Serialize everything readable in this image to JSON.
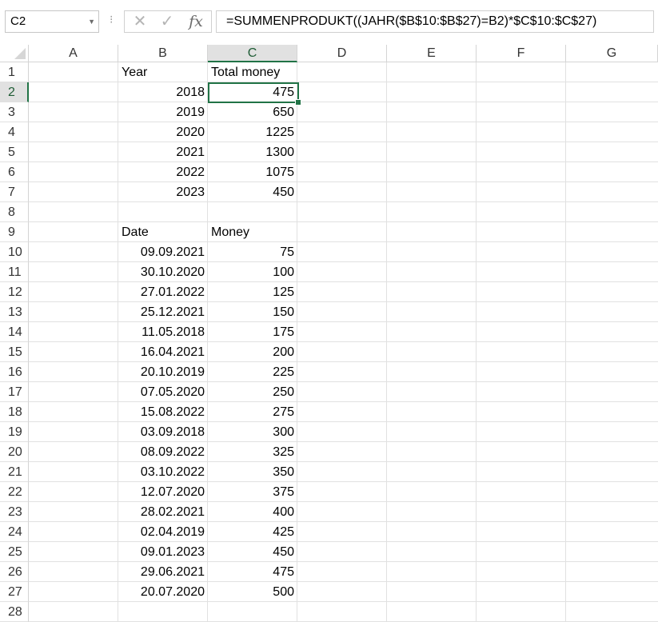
{
  "formula_bar": {
    "name_box": "C2",
    "formula": "=SUMMENPRODUKT((JAHR($B$10:$B$27)=B2)*$C$10:$C$27)",
    "cancel_glyph": "✕",
    "enter_glyph": "✓",
    "fx_label": "fx"
  },
  "columns": [
    "A",
    "B",
    "C",
    "D",
    "E",
    "F",
    "G"
  ],
  "selected_column": "C",
  "rows": [
    "1",
    "2",
    "3",
    "4",
    "5",
    "6",
    "7",
    "8",
    "9",
    "10",
    "11",
    "12",
    "13",
    "14",
    "15",
    "16",
    "17",
    "18",
    "19",
    "20",
    "21",
    "22",
    "23",
    "24",
    "25",
    "26",
    "27",
    "28"
  ],
  "selected_row": "2",
  "summary_table": {
    "header_year": "Year",
    "header_total": "Total money",
    "rows": [
      {
        "year": "2018",
        "total": "475"
      },
      {
        "year": "2019",
        "total": "650"
      },
      {
        "year": "2020",
        "total": "1225"
      },
      {
        "year": "2021",
        "total": "1300"
      },
      {
        "year": "2022",
        "total": "1075"
      },
      {
        "year": "2023",
        "total": "450"
      }
    ]
  },
  "detail_table": {
    "header_date": "Date",
    "header_money": "Money",
    "rows": [
      {
        "date": "09.09.2021",
        "money": "75"
      },
      {
        "date": "30.10.2020",
        "money": "100"
      },
      {
        "date": "27.01.2022",
        "money": "125"
      },
      {
        "date": "25.12.2021",
        "money": "150"
      },
      {
        "date": "11.05.2018",
        "money": "175"
      },
      {
        "date": "16.04.2021",
        "money": "200"
      },
      {
        "date": "20.10.2019",
        "money": "225"
      },
      {
        "date": "07.05.2020",
        "money": "250"
      },
      {
        "date": "15.08.2022",
        "money": "275"
      },
      {
        "date": "03.09.2018",
        "money": "300"
      },
      {
        "date": "08.09.2022",
        "money": "325"
      },
      {
        "date": "03.10.2022",
        "money": "350"
      },
      {
        "date": "12.07.2020",
        "money": "375"
      },
      {
        "date": "28.02.2021",
        "money": "400"
      },
      {
        "date": "02.04.2019",
        "money": "425"
      },
      {
        "date": "09.01.2023",
        "money": "450"
      },
      {
        "date": "29.06.2021",
        "money": "475"
      },
      {
        "date": "20.07.2020",
        "money": "500"
      }
    ]
  }
}
